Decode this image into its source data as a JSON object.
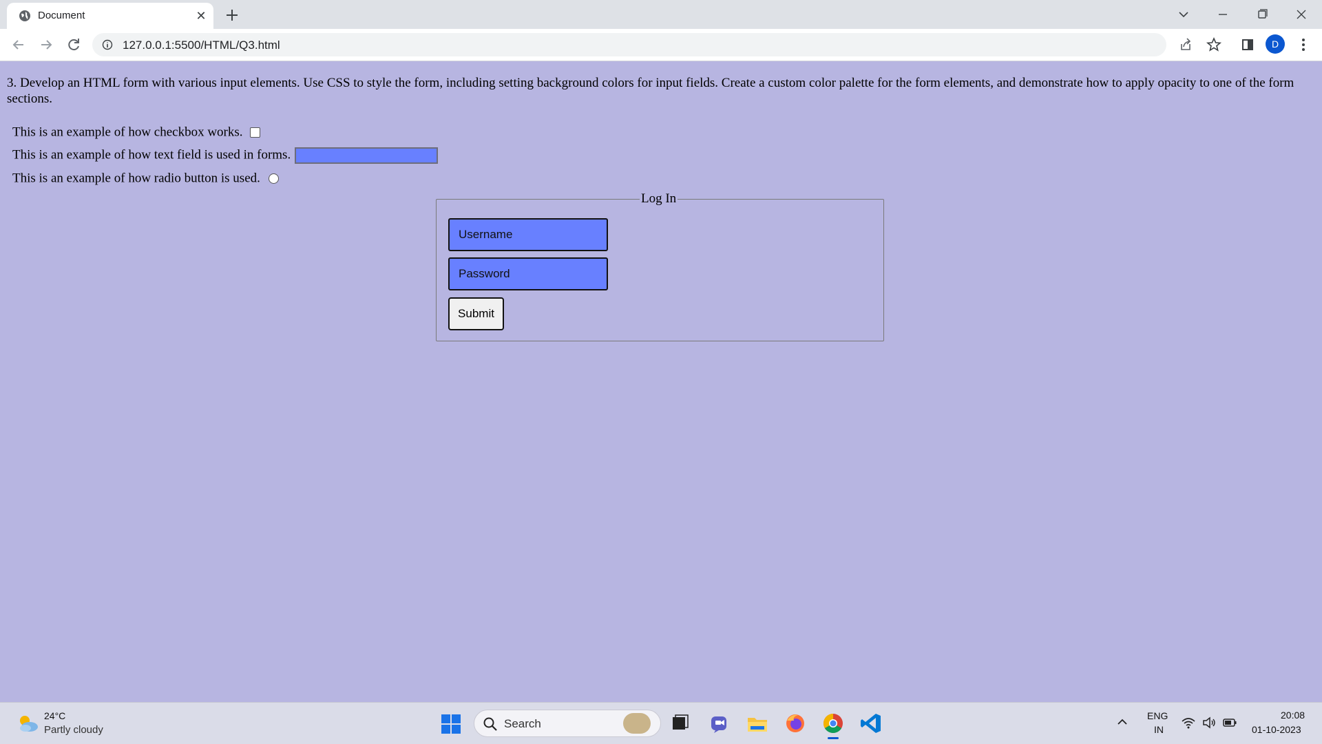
{
  "browser": {
    "tab_title": "Document",
    "url": "127.0.0.1:5500/HTML/Q3.html",
    "profile_initial": "D"
  },
  "page": {
    "question": "3. Develop an HTML form with various input elements. Use CSS to style the form, including setting background colors for input fields. Create a custom color palette for the form elements, and demonstrate how to apply opacity to one of the form sections.",
    "checkbox_label": "This is an example of how checkbox works.",
    "textfield_label": "This is an example of how text field is used in forms.",
    "radio_label": "This is an example of how radio button is used.",
    "fieldset_legend": "Log In",
    "username_placeholder": "Username",
    "password_placeholder": "Password",
    "submit_label": "Submit",
    "colors": {
      "page_background": "#b7b5e1",
      "input_background": "#6880ff"
    }
  },
  "taskbar": {
    "temperature": "24°C",
    "weather": "Partly cloudy",
    "search_label": "Search",
    "lang_top": "ENG",
    "lang_bottom": "IN",
    "time": "20:08",
    "date": "01-10-2023"
  }
}
